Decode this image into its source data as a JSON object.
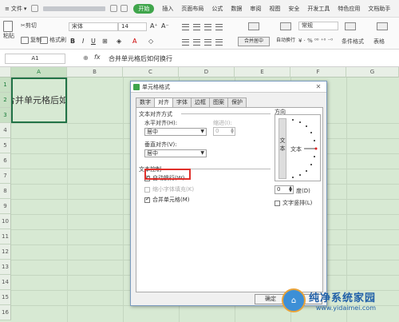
{
  "menubar": {
    "file_label": "文件",
    "start_label": "开始",
    "menus": [
      "插入",
      "页面布局",
      "公式",
      "数据",
      "审阅",
      "视图",
      "安全",
      "开发工具",
      "特色应用",
      "文档助手"
    ]
  },
  "ribbon": {
    "paste": "粘贴",
    "cut": "剪切",
    "copy": "复制",
    "format_painter": "格式刷",
    "font_name": "宋体",
    "font_size": "14",
    "merge_center": "合并居中",
    "wrap_text": "自动换行",
    "number_format": "常规",
    "number_symbols": "¥ · % ⁰⁰ ⁺⁰ ⁻⁰",
    "conditional_format": "条件格式",
    "table_style": "表格"
  },
  "formula_bar": {
    "cell_ref": "A1",
    "fx": "fx",
    "value": "合并单元格后如何换行"
  },
  "grid": {
    "columns": [
      "A",
      "B",
      "C",
      "D",
      "E",
      "F",
      "G"
    ],
    "rows": [
      "1",
      "2",
      "3",
      "4",
      "5",
      "6",
      "7",
      "8",
      "9",
      "10",
      "11",
      "12",
      "13",
      "14",
      "15",
      "16"
    ],
    "a1_text": "合并单元格后如何换行"
  },
  "dialog": {
    "title": "单元格格式",
    "tabs": [
      "数字",
      "对齐",
      "字体",
      "边框",
      "图案",
      "保护"
    ],
    "active_tab": "对齐",
    "text_align_section": "文本对齐方式",
    "horizontal_label": "水平对齐(H):",
    "horizontal_value": "居中",
    "indent_label": "缩进(I):",
    "indent_value": "0",
    "vertical_label": "垂直对齐(V):",
    "vertical_value": "居中",
    "text_control_section": "文本控制",
    "wrap_text": "自动换行(W)",
    "wrap_text_checked": true,
    "shrink_to_fit": "缩小字体填充(K)",
    "shrink_to_fit_checked": false,
    "merge_cells": "合并单元格(M)",
    "merge_cells_checked": true,
    "orientation_label": "方向",
    "vertical_text": "文本",
    "dial_text": "文本",
    "degree_value": "0",
    "degree_label": "度(D)",
    "text_vertical": "文字竖排(L)",
    "text_vertical_checked": false,
    "ok_button": "确定"
  },
  "watermark": {
    "title": "纯净系统家园",
    "url": "www.yidaimei.com"
  }
}
